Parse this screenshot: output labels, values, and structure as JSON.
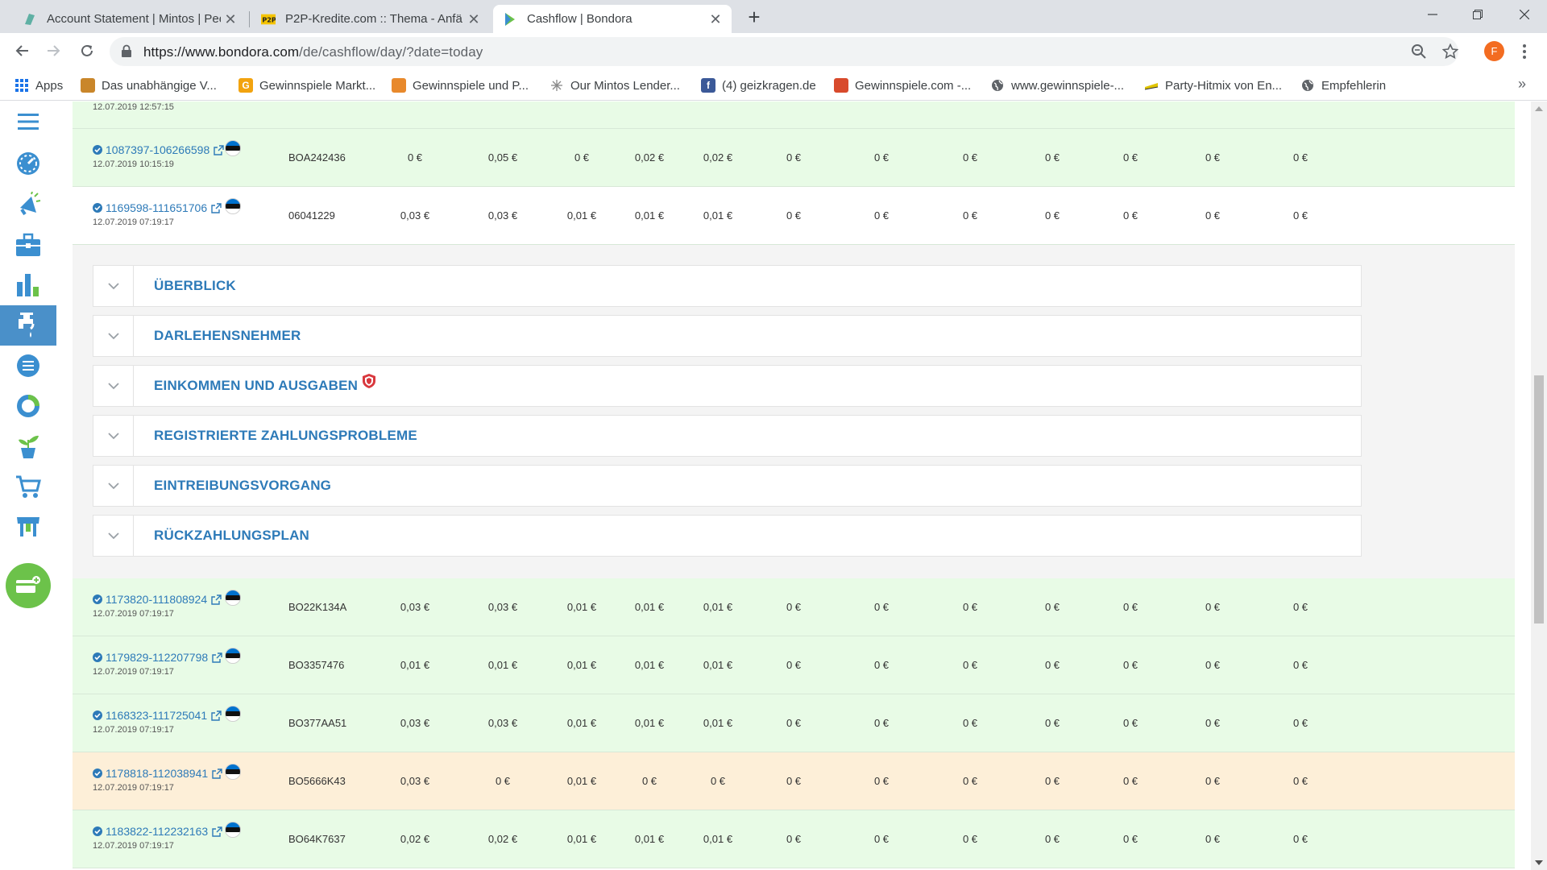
{
  "browser": {
    "tabs": [
      {
        "title": "Account Statement | Mintos | Pee",
        "close": "✕"
      },
      {
        "title": "P2P-Kredite.com :: Thema - Anfä",
        "close": "✕"
      },
      {
        "title": "Cashflow | Bondora",
        "close": "✕"
      }
    ],
    "new_tab": "+",
    "url_host": "https://www.bondora.com",
    "url_path": "/de/cashflow/day/?date=today",
    "profile_initial": "F",
    "bookmarks": [
      {
        "label": "Apps",
        "icon": "apps-grid-icon"
      },
      {
        "label": "Das unabhängige V...",
        "icon": "site-icon"
      },
      {
        "label": "Gewinnspiele Markt...",
        "icon": "site-icon"
      },
      {
        "label": "Gewinnspiele und P...",
        "icon": "site-icon"
      },
      {
        "label": "Our Mintos Lender...",
        "icon": "site-icon"
      },
      {
        "label": "(4) geizkragen.de",
        "icon": "facebook-icon"
      },
      {
        "label": "Gewinnspiele.com -...",
        "icon": "site-icon"
      },
      {
        "label": "www.gewinnspiele-...",
        "icon": "globe-icon"
      },
      {
        "label": "Party-Hitmix von En...",
        "icon": "site-icon"
      },
      {
        "label": "Empfehlerin",
        "icon": "globe-icon"
      }
    ],
    "bookmarks_more": "»"
  },
  "sidebar": {
    "items": [
      "menu-icon",
      "dashboard-icon",
      "promo-icon",
      "portfolio-icon",
      "stats-icon",
      "cashflow-icon",
      "statement-icon",
      "reports-icon",
      "growth-icon",
      "market-icon",
      "store-icon"
    ],
    "active": "cashflow-icon"
  },
  "top_partial_row": {
    "date": "12.07.2019 12:57:15"
  },
  "rows_above": [
    {
      "id": "1087397-106266598",
      "date": "12.07.2019 10:15:19",
      "ref": "BOA242436",
      "values": [
        "0 €",
        "0,05 €",
        "0 €",
        "0,02 €",
        "0,02 €",
        "0 €",
        "0 €",
        "0 €",
        "0 €",
        "0 €",
        "0 €",
        "0 €"
      ],
      "style": "green"
    },
    {
      "id": "1169598-111651706",
      "date": "12.07.2019 07:19:17",
      "ref": "06041229",
      "values": [
        "0,03 €",
        "0,03 €",
        "0,01 €",
        "0,01 €",
        "0,01 €",
        "0 €",
        "0 €",
        "0 €",
        "0 €",
        "0 €",
        "0 €",
        "0 €"
      ],
      "style": "white"
    }
  ],
  "detail_sections": [
    {
      "label": "ÜBERBLICK",
      "shield": false
    },
    {
      "label": "DARLEHENSNEHMER",
      "shield": false
    },
    {
      "label": "EINKOMMEN UND AUSGABEN",
      "shield": true
    },
    {
      "label": "REGISTRIERTE ZAHLUNGSPROBLEME",
      "shield": false
    },
    {
      "label": "EINTREIBUNGSVORGANG",
      "shield": false
    },
    {
      "label": "RÜCKZAHLUNGSPLAN",
      "shield": false
    }
  ],
  "rows_below": [
    {
      "id": "1173820-111808924",
      "date": "12.07.2019 07:19:17",
      "ref": "BO22K134A",
      "values": [
        "0,03 €",
        "0,03 €",
        "0,01 €",
        "0,01 €",
        "0,01 €",
        "0 €",
        "0 €",
        "0 €",
        "0 €",
        "0 €",
        "0 €",
        "0 €"
      ],
      "style": "green"
    },
    {
      "id": "1179829-112207798",
      "date": "12.07.2019 07:19:17",
      "ref": "BO3357476",
      "values": [
        "0,01 €",
        "0,01 €",
        "0,01 €",
        "0,01 €",
        "0,01 €",
        "0 €",
        "0 €",
        "0 €",
        "0 €",
        "0 €",
        "0 €",
        "0 €"
      ],
      "style": "green"
    },
    {
      "id": "1168323-111725041",
      "date": "12.07.2019 07:19:17",
      "ref": "BO377AA51",
      "values": [
        "0,03 €",
        "0,03 €",
        "0,01 €",
        "0,01 €",
        "0,01 €",
        "0 €",
        "0 €",
        "0 €",
        "0 €",
        "0 €",
        "0 €",
        "0 €"
      ],
      "style": "green"
    },
    {
      "id": "1178818-112038941",
      "date": "12.07.2019 07:19:17",
      "ref": "BO5666K43",
      "values": [
        "0,03 €",
        "0 €",
        "0,01 €",
        "0 €",
        "0 €",
        "0 €",
        "0 €",
        "0 €",
        "0 €",
        "0 €",
        "0 €",
        "0 €"
      ],
      "style": "orange"
    },
    {
      "id": "1183822-112232163",
      "date": "12.07.2019 07:19:17",
      "ref": "BO64K7637",
      "values": [
        "0,02 €",
        "0,02 €",
        "0,01 €",
        "0,01 €",
        "0,01 €",
        "0 €",
        "0 €",
        "0 €",
        "0 €",
        "0 €",
        "0 €",
        "0 €"
      ],
      "style": "green"
    }
  ],
  "colors": {
    "link": "#2d7ab8",
    "row_green": "#e8fbe6",
    "row_orange": "#fdefd8",
    "sidebar_active": "#4a90c9",
    "fab": "#6cc24a"
  }
}
